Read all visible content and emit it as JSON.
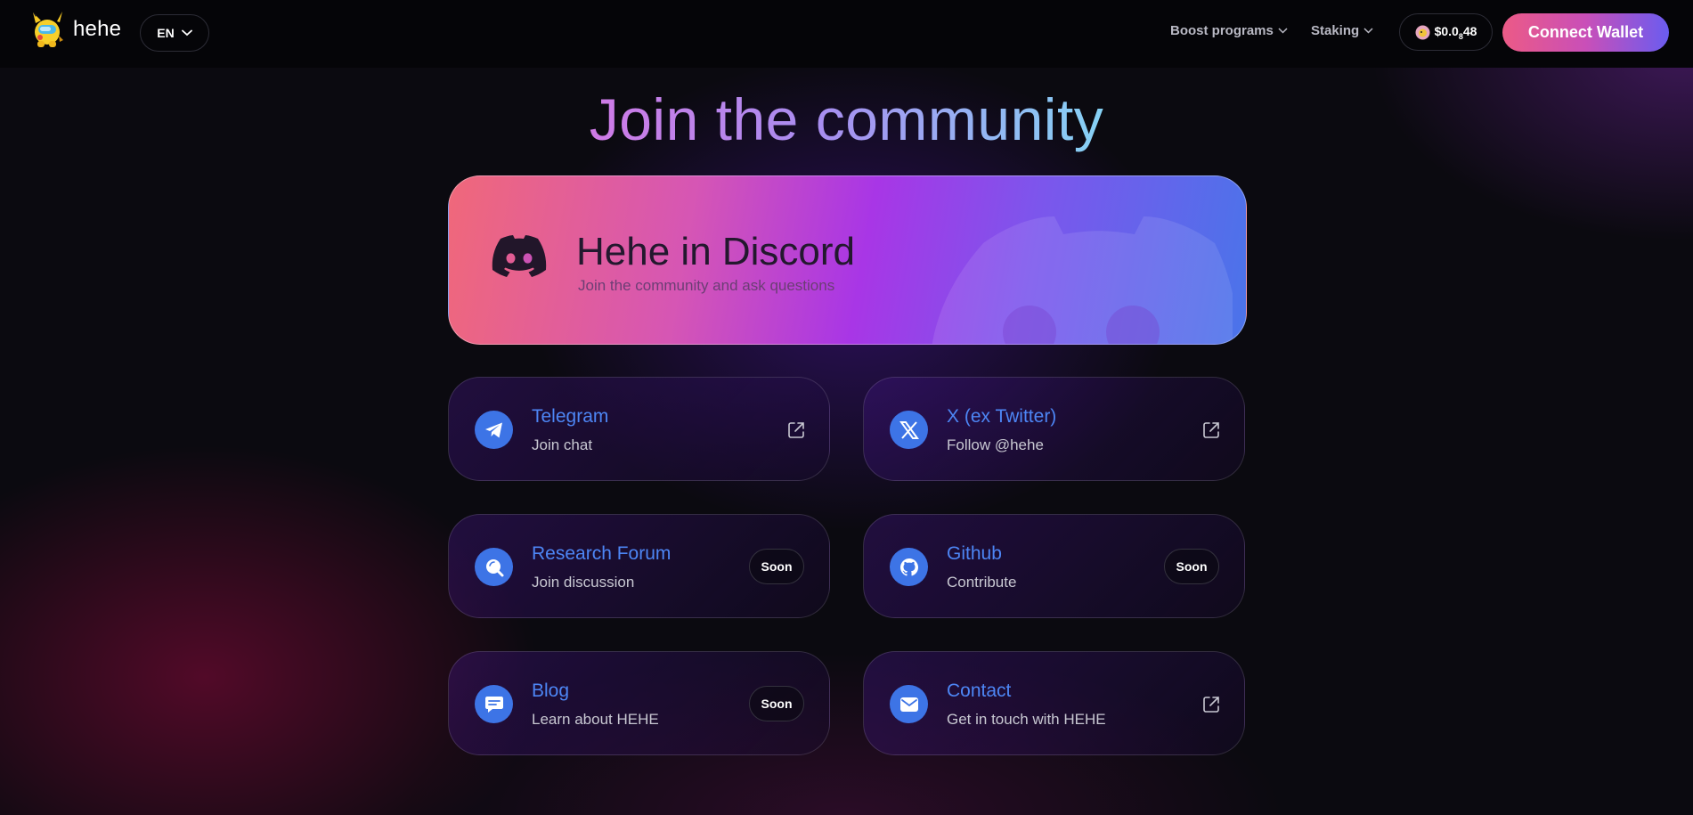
{
  "header": {
    "brand": "hehe",
    "language": "EN",
    "nav": [
      {
        "label": "Boost programs"
      },
      {
        "label": "Staking"
      }
    ],
    "price": {
      "prefix": "$0.0",
      "sub": "8",
      "suffix": "48"
    },
    "connect_label": "Connect Wallet"
  },
  "main": {
    "title": "Join the community",
    "discord": {
      "title": "Hehe in Discord",
      "subtitle": "Join the community and ask questions"
    },
    "cards": [
      {
        "title": "Telegram",
        "subtitle": "Join chat",
        "icon": "telegram-icon",
        "action": "external-link-icon"
      },
      {
        "title": "X (ex Twitter)",
        "subtitle": "Follow @hehe",
        "icon": "x-icon",
        "action": "external-link-icon"
      },
      {
        "title": "Research Forum",
        "subtitle": "Join discussion",
        "icon": "forum-icon",
        "badge": "Soon"
      },
      {
        "title": "Github",
        "subtitle": "Contribute",
        "icon": "github-icon",
        "badge": "Soon"
      },
      {
        "title": "Blog",
        "subtitle": "Learn about HEHE",
        "icon": "chat-bubble-icon",
        "badge": "Soon"
      },
      {
        "title": "Contact",
        "subtitle": "Get in touch with HEHE",
        "icon": "mail-icon",
        "action": "external-link-icon"
      }
    ]
  },
  "colors": {
    "accent_blue": "#4d86f5",
    "icon_bg": "#3d74e6",
    "connect_gradient": [
      "#ec5a86",
      "#6a5cf0"
    ],
    "discord_gradient": [
      "#f0687a",
      "#a836e6",
      "#4a74ea"
    ]
  }
}
